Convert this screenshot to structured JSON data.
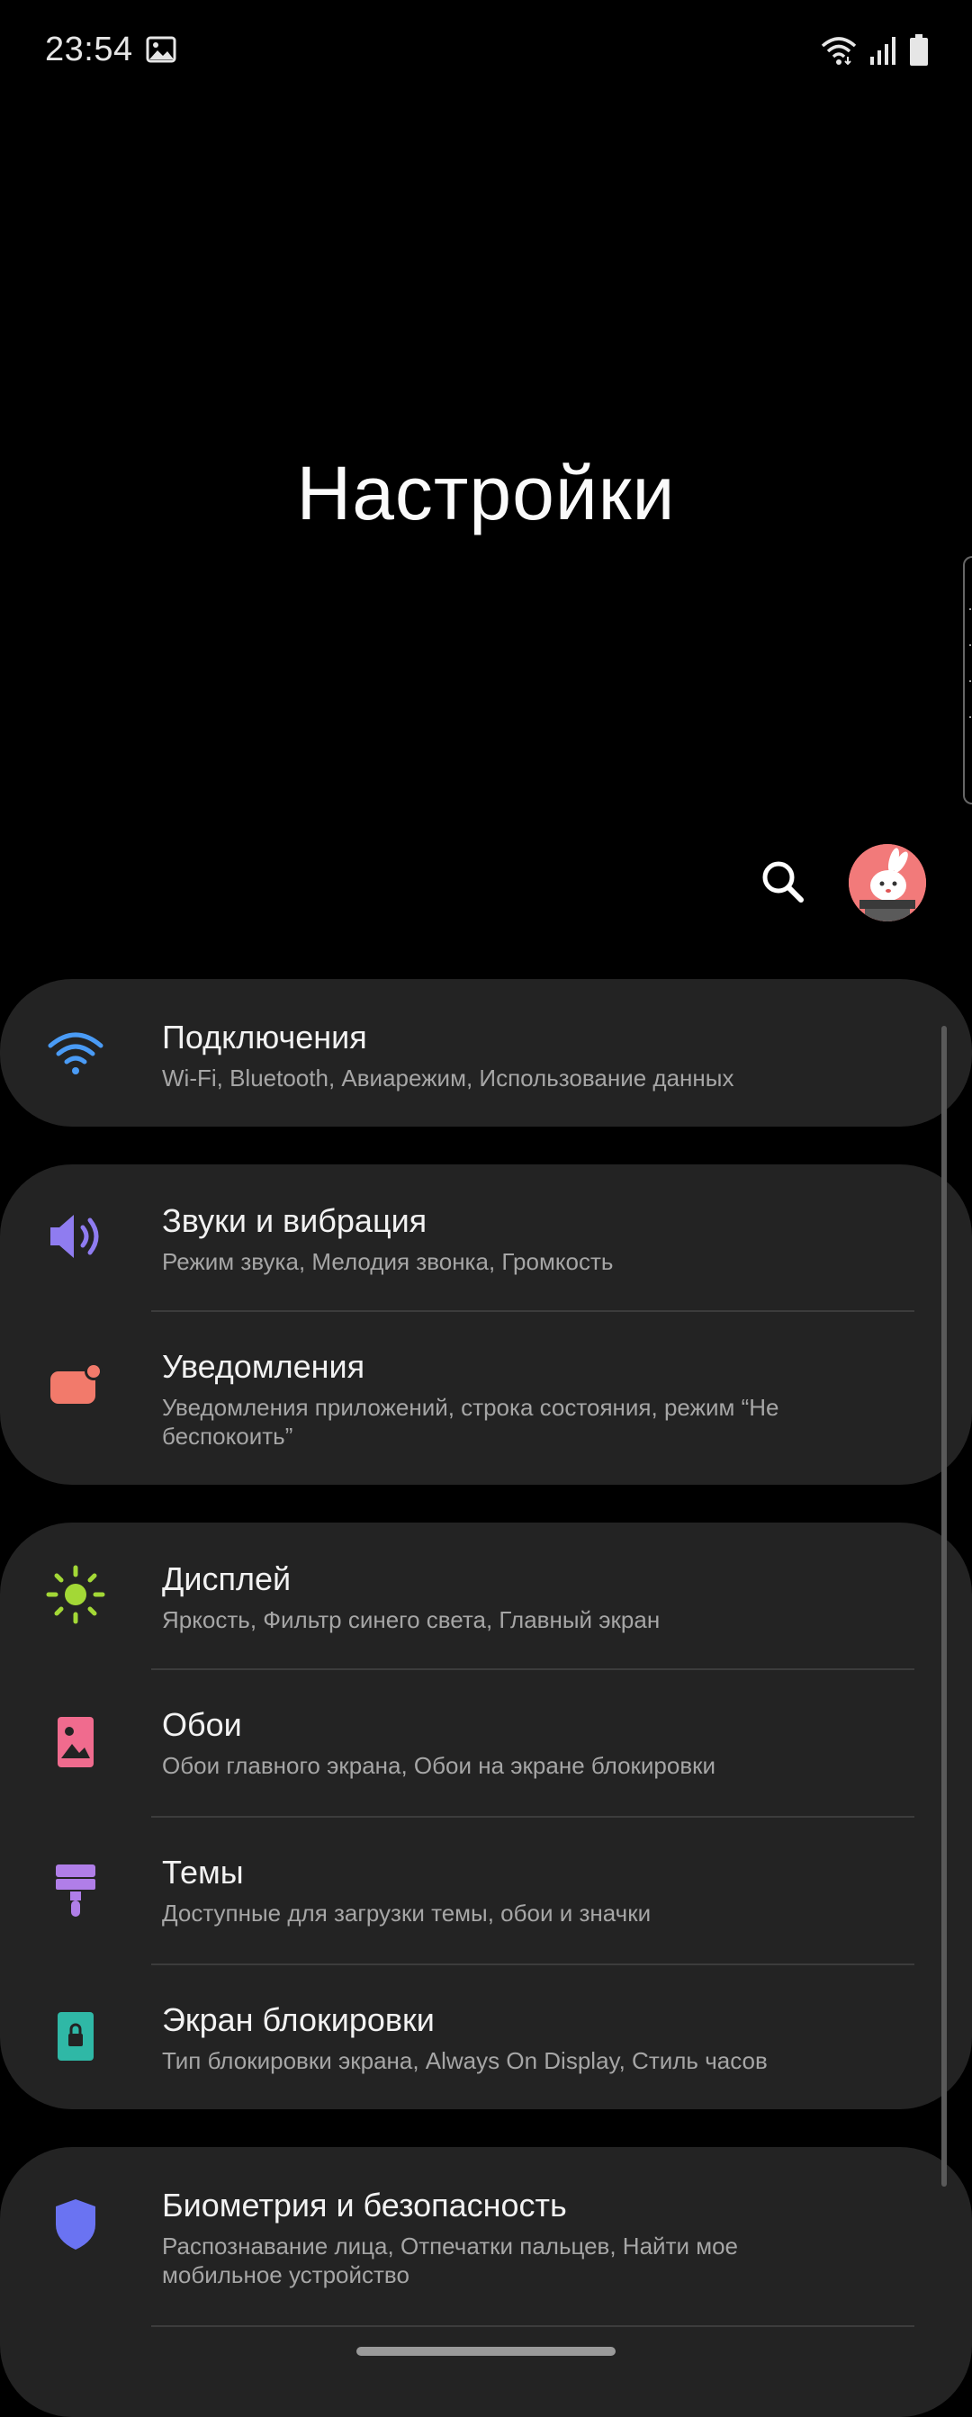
{
  "status_bar": {
    "time": "23:54",
    "icons": [
      "image-icon",
      "wifi-icon",
      "signal-icon",
      "battery-icon"
    ]
  },
  "page": {
    "title": "Настройки"
  },
  "header_actions": {
    "search_icon": "search-icon",
    "avatar": "profile-avatar"
  },
  "colors": {
    "background": "#000000",
    "card": "#232323",
    "connections_icon": "#4a9bf5",
    "sounds_icon": "#8f7cf0",
    "notifications_icon": "#f27a6b",
    "display_icon": "#a3d836",
    "wallpaper_icon": "#f06b8e",
    "themes_icon": "#b07ee8",
    "lockscreen_icon": "#2fb8a6",
    "biometrics_icon": "#6a73f2"
  },
  "groups": [
    {
      "items": [
        {
          "icon": "wifi-icon",
          "title": "Подключения",
          "subtitle": "Wi-Fi, Bluetooth, Авиарежим, Использование данных"
        }
      ]
    },
    {
      "items": [
        {
          "icon": "speaker-icon",
          "title": "Звуки и вибрация",
          "subtitle": "Режим звука, Мелодия звонка, Громкость"
        },
        {
          "icon": "notification-icon",
          "title": "Уведомления",
          "subtitle": "Уведомления приложений, строка состояния, режим “Не беспокоить”"
        }
      ]
    },
    {
      "items": [
        {
          "icon": "sun-icon",
          "title": "Дисплей",
          "subtitle": "Яркость, Фильтр синего света, Главный экран"
        },
        {
          "icon": "wallpaper-icon",
          "title": "Обои",
          "subtitle": "Обои главного экрана, Обои на экране блокировки"
        },
        {
          "icon": "paintbrush-icon",
          "title": "Темы",
          "subtitle": "Доступные для загрузки темы, обои и значки"
        },
        {
          "icon": "lock-icon",
          "title": "Экран блокировки",
          "subtitle": "Тип блокировки экрана, Always On Display, Стиль часов"
        }
      ]
    },
    {
      "items": [
        {
          "icon": "shield-icon",
          "title": "Биометрия и безопасность",
          "subtitle": "Распознавание лица, Отпечатки пальцев, Найти мое мобильное устройство"
        }
      ]
    }
  ]
}
